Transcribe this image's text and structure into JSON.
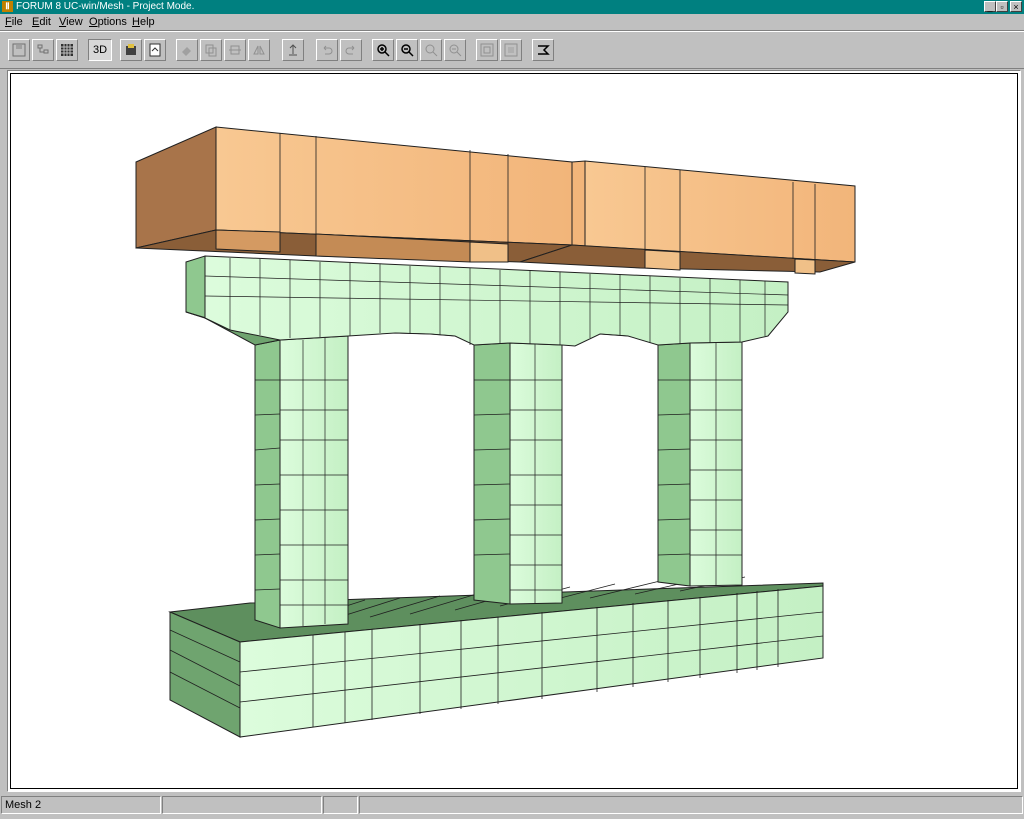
{
  "window": {
    "title": "FORUM 8   UC-win/Mesh - Project Mode.",
    "app_icon": "forum8-icon",
    "minimize_glyph": "_",
    "restore_glyph": "▫",
    "close_glyph": "×"
  },
  "menu": {
    "items": [
      {
        "label": "File",
        "accel": "F",
        "rest": "ile"
      },
      {
        "label": "Edit",
        "accel": "E",
        "rest": "dit"
      },
      {
        "label": "View",
        "accel": "V",
        "rest": "iew"
      },
      {
        "label": "Options",
        "accel": "O",
        "rest": "ptions"
      },
      {
        "label": "Help",
        "accel": "H",
        "rest": "elp"
      }
    ]
  },
  "toolbar": {
    "view_3d_label": "3D",
    "buttons": [
      "save-icon",
      "tree-icon",
      "grid-icon",
      "3d-view",
      "import-icon",
      "export-icon",
      "fill-icon",
      "copy-icon",
      "move-icon",
      "mirror-icon",
      "lift-icon",
      "undo-icon",
      "redo-icon",
      "zoom-in-icon",
      "zoom-out-icon",
      "zoom-window-icon",
      "zoom-previous-icon",
      "fit-all-icon",
      "fit-select-icon",
      "settings-icon"
    ]
  },
  "colors": {
    "deck_top": "#f6c890",
    "deck_front": "#f4bb80",
    "deck_side": "#a8744a",
    "pier_face": "#d8fcd8",
    "pier_shade": "#8cc88c",
    "pier_dark": "#5a8e5a",
    "outline": "#202020"
  },
  "status": {
    "panel1": "Mesh 2",
    "panel2": "",
    "panel3": "",
    "panel4": ""
  }
}
